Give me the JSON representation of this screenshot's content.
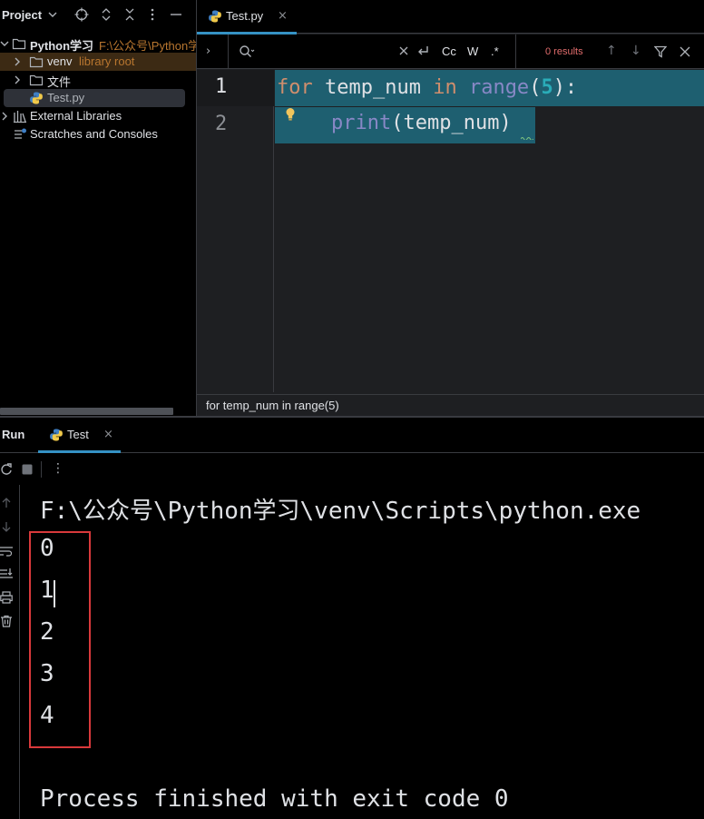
{
  "project": {
    "title": "Project",
    "tree": [
      {
        "label": "Python学习",
        "hint": "F:\\公众号\\Python学"
      },
      {
        "label": "venv",
        "hint": "library root"
      },
      {
        "label": "文件"
      },
      {
        "label": "Test.py"
      },
      {
        "label": "External Libraries"
      },
      {
        "label": "Scratches and Consoles"
      }
    ]
  },
  "editor": {
    "tab": {
      "label": "Test.py",
      "close": "×"
    },
    "find": {
      "expand": "›",
      "query": "",
      "options": {
        "cc": "Cc",
        "w": "W",
        "regex": ".*"
      },
      "results": "0 results",
      "up": "↑",
      "down": "↓"
    },
    "line_numbers": [
      "1",
      "2"
    ],
    "code": {
      "line1": {
        "kw_for": "for",
        "var": " temp_num ",
        "kw_in": "in",
        "sp": " ",
        "fn": "range",
        "open": "(",
        "num": "5",
        "close": "):"
      },
      "line2": {
        "fn": "print",
        "rest": "(temp_num)"
      }
    },
    "breadcrumb": "for temp_num in range(5)"
  },
  "run": {
    "title": "Run",
    "tab": {
      "label": "Test",
      "close": "×"
    },
    "menu": "⋮",
    "console": {
      "command": "F:\\公众号\\Python学习\\venv\\Scripts\\python.exe",
      "output": [
        "0",
        "1",
        "2",
        "3",
        "4"
      ],
      "finished": "Process finished with exit code 0"
    }
  },
  "colors": {
    "selection": "#1e5f70",
    "keyword": "#cf8e6d",
    "number": "#2aacb8",
    "builtin": "#8888c6",
    "highlight_box": "#d9393b",
    "active_tab_underline": "#3592c4"
  }
}
